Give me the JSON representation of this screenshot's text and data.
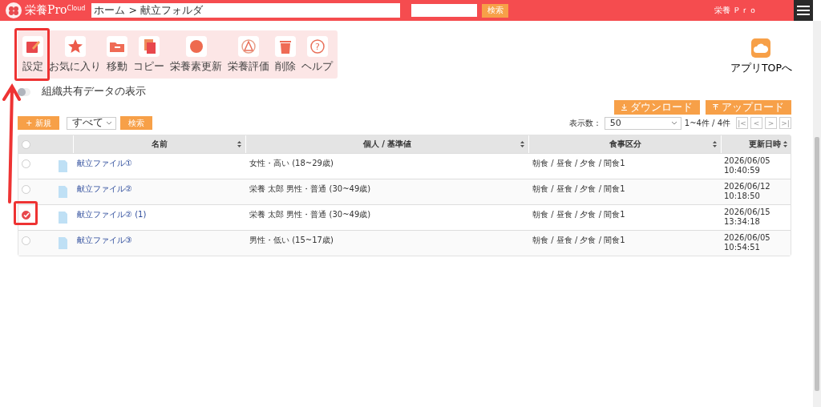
{
  "header": {
    "logo_text": "栄養Pro",
    "logo_badge": "Cloud",
    "breadcrumb": "ホーム > 献立フォルダ",
    "search_button": "検索",
    "user": "栄養 Ｐｒｏ"
  },
  "toolbar": [
    {
      "label": "設定",
      "kind": "edit"
    },
    {
      "label": "お気に入り",
      "kind": "star"
    },
    {
      "label": "移動",
      "kind": "folder"
    },
    {
      "label": "コピー",
      "kind": "copy"
    },
    {
      "label": "栄養素更新",
      "kind": "circle"
    },
    {
      "label": "栄養評価",
      "kind": "triangle"
    },
    {
      "label": "削除",
      "kind": "trash"
    },
    {
      "label": "ヘルプ",
      "kind": "help",
      "glyph": "?"
    }
  ],
  "app_top": "アプリTOPへ",
  "share_toggle": {
    "label": "組織共有データの表示",
    "on": false
  },
  "download": "ダウンロード",
  "upload": "アップロード",
  "new_button": "+ 新規",
  "filter": {
    "value": "すべて"
  },
  "filter_search": "検索",
  "page_size": {
    "label": "表示数：",
    "value": "50"
  },
  "range": "1~4件 / 4件",
  "pager": [
    "|<",
    "<",
    ">",
    ">|"
  ],
  "table": {
    "select_all": {
      "checked": false
    },
    "columns": [
      "名前",
      "個人 / 基準値",
      "食事区分",
      "更新日時"
    ],
    "rows": [
      {
        "name": "献立ファイル①",
        "person": "女性・高い (18~29歳)",
        "meals": "朝食 / 昼食 / 夕食 / 間食1",
        "date": "2026/06/05",
        "time": "10:40:59",
        "selected": false
      },
      {
        "name": "献立ファイル②",
        "person": "栄養 太郎 男性・普通 (30~49歳)",
        "meals": "朝食 / 昼食 / 夕食 / 間食1",
        "date": "2026/06/12",
        "time": "10:18:50",
        "selected": false
      },
      {
        "name": "献立ファイル② (1)",
        "person": "栄養 太郎 男性・普通 (30~49歳)",
        "meals": "朝食 / 昼食 / 夕食 / 間食1",
        "date": "2026/06/15",
        "time": "13:34:18",
        "selected": true
      },
      {
        "name": "献立ファイル③",
        "person": "男性・低い (15~17歳)",
        "meals": "朝食 / 昼食 / 夕食 / 間食1",
        "date": "2026/06/05",
        "time": "10:54:51",
        "selected": false
      }
    ]
  }
}
